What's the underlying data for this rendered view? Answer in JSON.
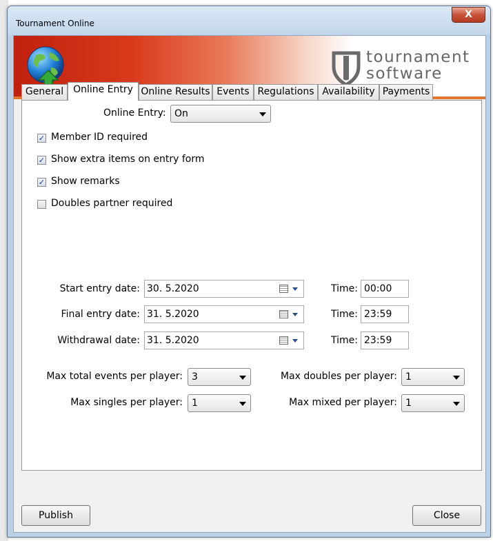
{
  "window": {
    "title": "Tournament Online",
    "close_symbol": "X"
  },
  "banner": {
    "globe_icon": "globe-upload-icon",
    "brand_line1": "tournament",
    "brand_line2": "software",
    "brand_icon": "shield-icon",
    "colors": {
      "red": "#c0200e",
      "orange_rule": "#e3762e"
    }
  },
  "tabs": [
    {
      "label": "General",
      "active": false
    },
    {
      "label": "Online Entry",
      "active": true
    },
    {
      "label": "Online Results",
      "active": false
    },
    {
      "label": "Events",
      "active": false
    },
    {
      "label": "Regulations",
      "active": false
    },
    {
      "label": "Availability",
      "active": false
    },
    {
      "label": "Payments",
      "active": false
    }
  ],
  "online_entry": {
    "label": "Online Entry:",
    "value": "On"
  },
  "checkboxes": [
    {
      "label": "Member ID required",
      "checked": true
    },
    {
      "label": "Show extra items on entry form",
      "checked": true
    },
    {
      "label": "Show remarks",
      "checked": true
    },
    {
      "label": "Doubles partner required",
      "checked": false
    }
  ],
  "dates": {
    "start": {
      "label": "Start entry date:",
      "value": "30.  5.2020",
      "time_label": "Time:",
      "time": "00:00"
    },
    "final": {
      "label": "Final entry date:",
      "value": "31.  5.2020",
      "time_label": "Time:",
      "time": "23:59"
    },
    "withdrawal": {
      "label": "Withdrawal date:",
      "value": "31.  5.2020",
      "time_label": "Time:",
      "time": "23:59"
    }
  },
  "limits": {
    "max_total": {
      "label": "Max total events per player:",
      "value": "3"
    },
    "max_singles": {
      "label": "Max singles per player:",
      "value": "1"
    },
    "max_doubles": {
      "label": "Max doubles per player:",
      "value": "1"
    },
    "max_mixed": {
      "label": "Max mixed per player:",
      "value": "1"
    }
  },
  "buttons": {
    "publish": "Publish",
    "close": "Close"
  }
}
